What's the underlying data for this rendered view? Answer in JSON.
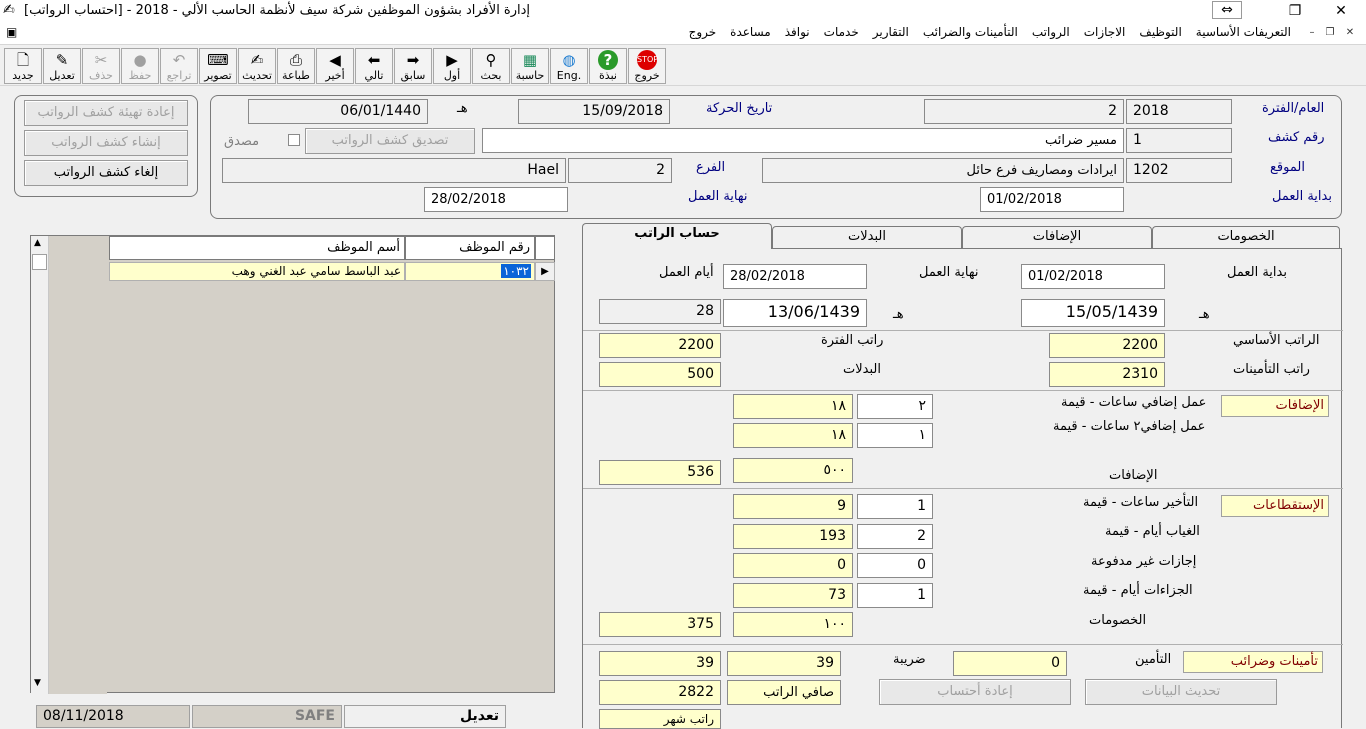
{
  "window": {
    "title": "إدارة الأفراد بشؤون الموظفين شركة سيف لأنظمة الحاسب الألي - 2018 - [احتساب الرواتب]",
    "restore_glyph": "⇔",
    "maximize_glyph": "❐",
    "close_glyph": "✕"
  },
  "menu": {
    "items": [
      "التعريفات الأساسية",
      "التوظيف",
      "الاجازات",
      "الرواتب",
      "التأمينات والضرائب",
      "التقارير",
      "خدمات",
      "نوافذ",
      "مساعدة",
      "خروج"
    ],
    "mdi_minimize": "–",
    "mdi_restore": "❐",
    "mdi_close": "✕"
  },
  "toolbar": {
    "buttons": [
      {
        "label": "جديد",
        "icon": "new-document-icon",
        "glyph": "🗋"
      },
      {
        "label": "تعديل",
        "icon": "edit-icon",
        "glyph": "✎"
      },
      {
        "label": "حذف",
        "icon": "scissors-icon",
        "glyph": "✂"
      },
      {
        "label": "حفظ",
        "icon": "save-icon",
        "glyph": "●"
      },
      {
        "label": "تراجع",
        "icon": "undo-icon",
        "glyph": "↶"
      },
      {
        "label": "تصوير",
        "icon": "scanner-icon",
        "glyph": "⌨"
      },
      {
        "label": "تحديث",
        "icon": "refresh-icon",
        "glyph": "✍"
      },
      {
        "label": "طباعة",
        "icon": "printer-icon",
        "glyph": "⎙"
      },
      {
        "label": "أخير",
        "icon": "last-record-icon",
        "glyph": "◀"
      },
      {
        "label": "تالي",
        "icon": "next-record-icon",
        "glyph": "⬅"
      },
      {
        "label": "سابق",
        "icon": "previous-record-icon",
        "glyph": "➡"
      },
      {
        "label": "أول",
        "icon": "first-record-icon",
        "glyph": "▶"
      },
      {
        "label": "بحث",
        "icon": "binoculars-icon",
        "glyph": "⚲"
      },
      {
        "label": "حاسبة",
        "icon": "calculator-icon",
        "glyph": "▦"
      },
      {
        "label": "Eng.",
        "icon": "globe-icon",
        "glyph": "◍"
      },
      {
        "label": "نبذة",
        "icon": "help-icon",
        "glyph": "?"
      },
      {
        "label": "خروج",
        "icon": "stop-icon",
        "glyph": "STOP"
      }
    ]
  },
  "side_buttons": {
    "reprepare": "إعادة تهيئة كشف الرواتب",
    "create": "إنشاء كشف الرواتب",
    "cancel": "إلغاء كشف الرواتب"
  },
  "header": {
    "year_period_label": "العام/الفترة",
    "year": "2018",
    "period": "2",
    "movement_date_label": "تاريخ الحركة",
    "movement_date": "15/09/2018",
    "hijri_suffix": "هـ",
    "movement_date_hijri": "06/01/1440",
    "statement_no_label": "رقم كشف",
    "statement_no": "1",
    "statement_desc": "مسير ضرائب",
    "approve_button": "تصديق كشف الرواتب",
    "approved_label": "مصدق",
    "location_label": "الموقع",
    "location_code": "1202",
    "location_name": "ايرادات ومصاريف فرع حائل",
    "branch_label": "الفرع",
    "branch_code": "2",
    "branch_name": "Hael",
    "work_start_label": "بداية العمل",
    "work_start": "01/02/2018",
    "work_end_label": "نهاية العمل",
    "work_end": "28/02/2018"
  },
  "grid": {
    "col_emp_no": "رقم الموظف",
    "col_emp_name": "أسم الموظف",
    "rows": [
      {
        "emp_no": "١٠٣٢",
        "emp_name": "عبد الباسط سامي عبد الغني وهب"
      }
    ]
  },
  "tabs": [
    "حساب الراتب",
    "البدلات",
    "الإضافات",
    "الخصومات"
  ],
  "salary": {
    "work_start_label": "بداية العمل",
    "work_start": "01/02/2018",
    "work_end_label": "نهاية العمل",
    "work_end": "28/02/2018",
    "work_days_label": "أيام العمل",
    "work_days": "28",
    "hijri_suffix": "هـ",
    "start_hijri": "15/05/1439",
    "end_hijri": "13/06/1439",
    "basic_salary_label": "الراتب الأساسي",
    "basic_salary": "2200",
    "period_salary_label": "راتب الفترة",
    "period_salary": "2200",
    "insurance_salary_label": "راتب التأمينات",
    "insurance_salary": "2310",
    "allowances_label": "البدلات",
    "allowances": "500",
    "additions_tag": "الإضافات",
    "overtime1_label": "عمل إضافي ساعات - قيمة",
    "overtime1_hours": "٢",
    "overtime1_value": "١٨",
    "overtime2_label": "عمل إضافي٢ ساعات - قيمة",
    "overtime2_hours": "١",
    "overtime2_value": "١٨",
    "additions_label": "الإضافات",
    "additions_sub": "٥٠٠",
    "additions_total": "536",
    "deductions_tag": "الإستقطاعات",
    "late_label": "التأخير ساعات - قيمة",
    "late_hours": "1",
    "late_value": "9",
    "absence_label": "الغياب أيام - قيمة",
    "absence_days": "2",
    "absence_value": "193",
    "unpaid_label": "إجازات غير مدفوعة",
    "unpaid_days": "0",
    "unpaid_value": "0",
    "penalties_label": "الجزاءات أيام - قيمة",
    "penalties_days": "1",
    "penalties_value": "73",
    "deductions_label": "الخصومات",
    "deductions_sub": "١٠٠",
    "deductions_total": "375",
    "ins_tax_tag": "تأمينات وضرائب",
    "insurance_label": "التأمين",
    "insurance": "0",
    "tax_label": "ضريبة",
    "tax": "39",
    "tax_total": "39",
    "net_label": "صافي الراتب",
    "net": "2822",
    "recalc_button": "إعادة أحتساب",
    "update_button": "تحديث البيانات",
    "monthly_label": "راتب شهر"
  },
  "status": {
    "mode": "تعديل",
    "safe": "SAFE",
    "date": "08/11/2018"
  }
}
